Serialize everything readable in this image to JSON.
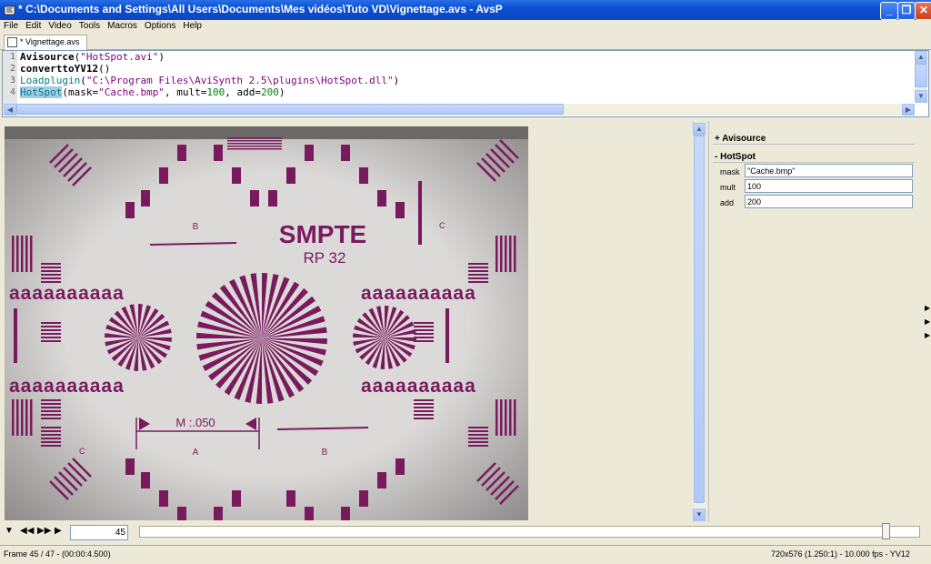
{
  "window": {
    "title": "* C:\\Documents and Settings\\All Users\\Documents\\Mes vidéos\\Tuto VD\\Vignettage.avs - AvsP",
    "minimize": "_",
    "maximize": "❐",
    "close": "✕"
  },
  "menu": [
    "File",
    "Edit",
    "Video",
    "Tools",
    "Macros",
    "Options",
    "Help"
  ],
  "tab": {
    "label": "* Vignettage.avs"
  },
  "editor": {
    "line_numbers": [
      "1",
      "2",
      "3",
      "4"
    ],
    "lines": [
      {
        "fn": "Avisource",
        "open": "(",
        "arg": "\"HotSpot.avi\"",
        "close": ")"
      },
      {
        "fn": "converttoYV12",
        "open": "()"
      },
      {
        "fn": "Loadplugin",
        "open": "(",
        "arg": "\"C:\\Program Files\\AviSynth 2.5\\plugins\\HotSpot.dll\"",
        "close": ")"
      },
      {
        "fn": "HotSpot",
        "open": "(mask=",
        "arg": "\"Cache.bmp\"",
        "mid1": ", mult=",
        "num1": "100",
        "mid2": ", add=",
        "num2": "200",
        "close": ")"
      }
    ]
  },
  "chart_text": {
    "title": "SMPTE",
    "subtitle": "RP 32",
    "m_label": "M :.050",
    "b_label": "B",
    "a_label": "A",
    "c_label": "C",
    "a_row": "aaaaaaaaaa"
  },
  "panel": {
    "sections": [
      {
        "sign": "+",
        "name": "Avisource"
      },
      {
        "sign": "-",
        "name": "HotSpot"
      }
    ],
    "params": [
      {
        "label": "mask",
        "value": "\"Cache.bmp\""
      },
      {
        "label": "mult",
        "value": "100"
      },
      {
        "label": "add",
        "value": "200"
      }
    ]
  },
  "controls": {
    "frame_value": "45",
    "slider_position": 0.957
  },
  "status": {
    "left": "Frame 45 / 47  -  (00:00:4.500)",
    "right": "720x576 (1.250:1)  -  10.000 fps  -  YV12"
  }
}
